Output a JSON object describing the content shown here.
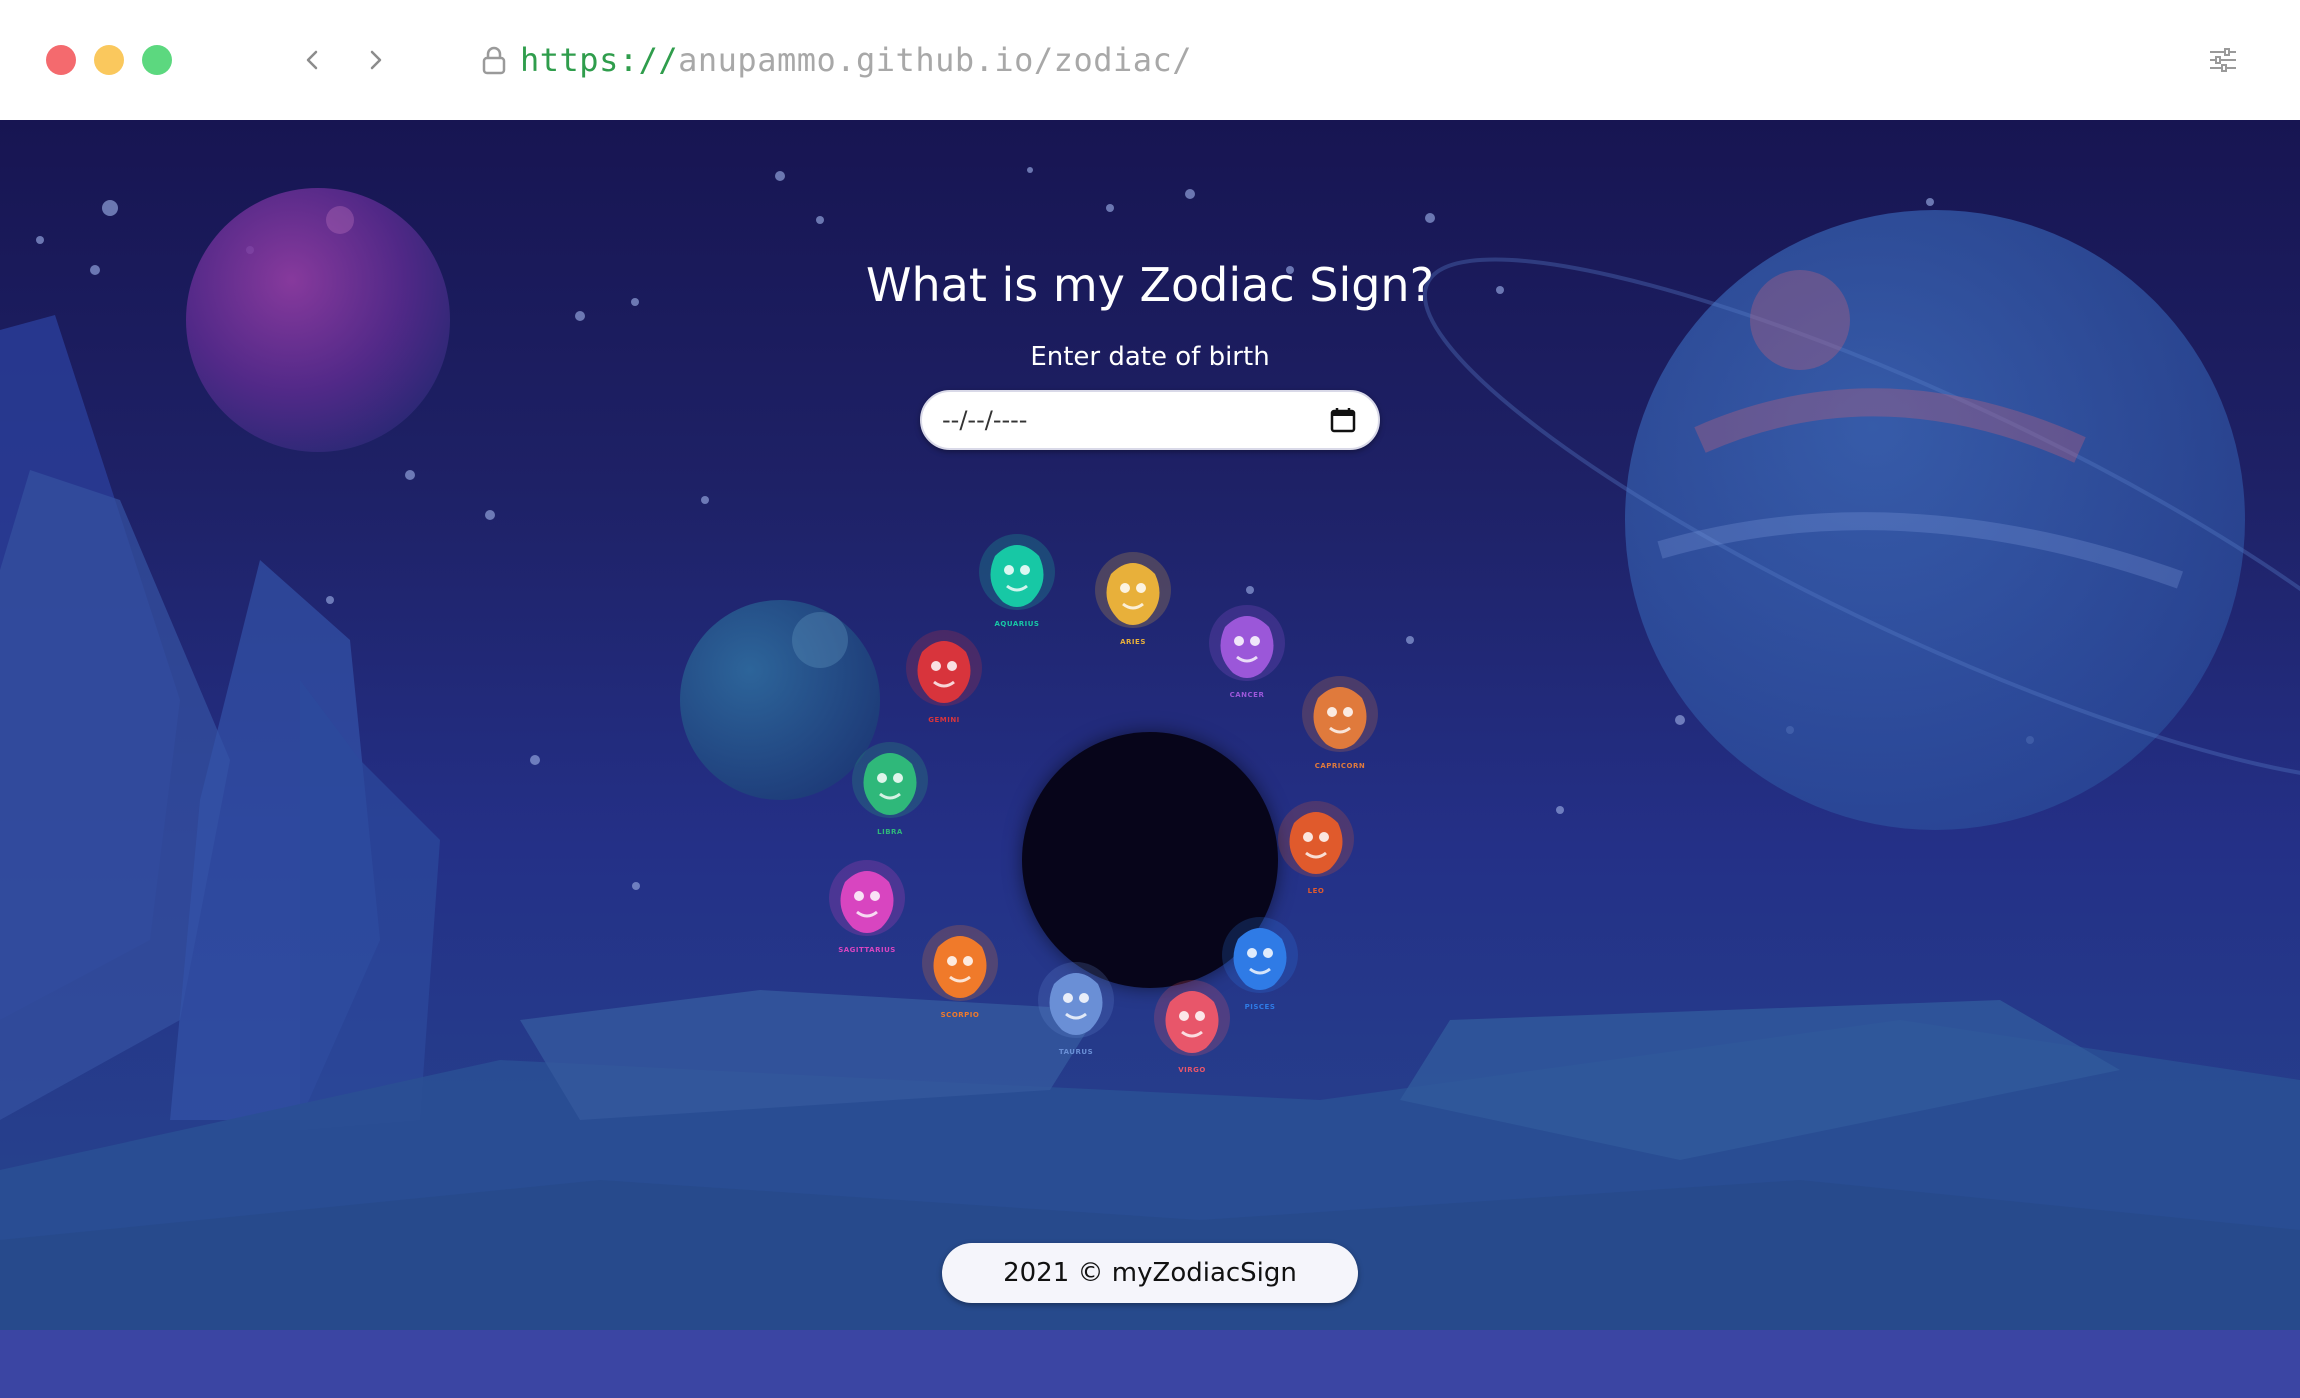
{
  "browser": {
    "url_scheme": "https://",
    "url_rest": "anupammo.github.io/zodiac/"
  },
  "page": {
    "title": "What is my Zodiac Sign?",
    "date_label": "Enter date of birth",
    "date_placeholder": "--/--/----",
    "footer": "2021 © myZodiacSign"
  },
  "signs": [
    {
      "name": "AQUARIUS",
      "color": "#17c8a5"
    },
    {
      "name": "ARIES",
      "color": "#e8b03a"
    },
    {
      "name": "CANCER",
      "color": "#9b57d9"
    },
    {
      "name": "CAPRICORN",
      "color": "#e07a3c"
    },
    {
      "name": "LEO",
      "color": "#e05a2c"
    },
    {
      "name": "PISCES",
      "color": "#2f7be6"
    },
    {
      "name": "VIRGO",
      "color": "#e8566a"
    },
    {
      "name": "TAURUS",
      "color": "#6a8fd6"
    },
    {
      "name": "SCORPIO",
      "color": "#f07a2a"
    },
    {
      "name": "SAGITTARIUS",
      "color": "#d845c0"
    },
    {
      "name": "LIBRA",
      "color": "#2fb87a"
    },
    {
      "name": "GEMINI",
      "color": "#d8343c"
    }
  ]
}
